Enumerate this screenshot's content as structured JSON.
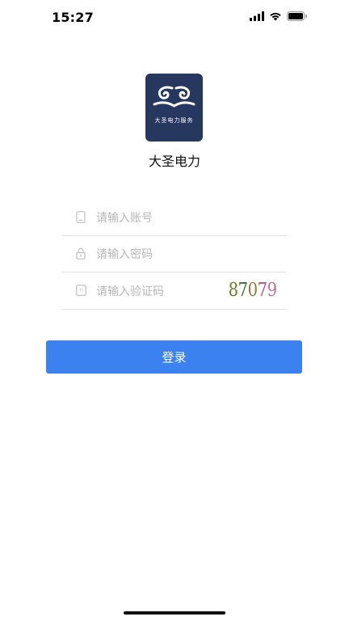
{
  "status_bar": {
    "time": "15:27",
    "icons": [
      "cellular-signal-icon",
      "wifi-icon",
      "battery-icon"
    ]
  },
  "logo": {
    "text": "大圣电力服务",
    "background_color": "#26385f"
  },
  "app_name": "大圣电力",
  "form": {
    "account_placeholder": "请输入账号",
    "password_placeholder": "请输入密码",
    "captcha_placeholder": "请输入验证码",
    "captcha_code": [
      "8",
      "7",
      "0",
      "7",
      "9"
    ],
    "captcha_colors": [
      "#6b7a2a",
      "#3d6b3d",
      "#8a7a3a",
      "#b0566e",
      "#c0708a"
    ]
  },
  "login_button": {
    "label": "登录",
    "color": "#3b82f0"
  }
}
